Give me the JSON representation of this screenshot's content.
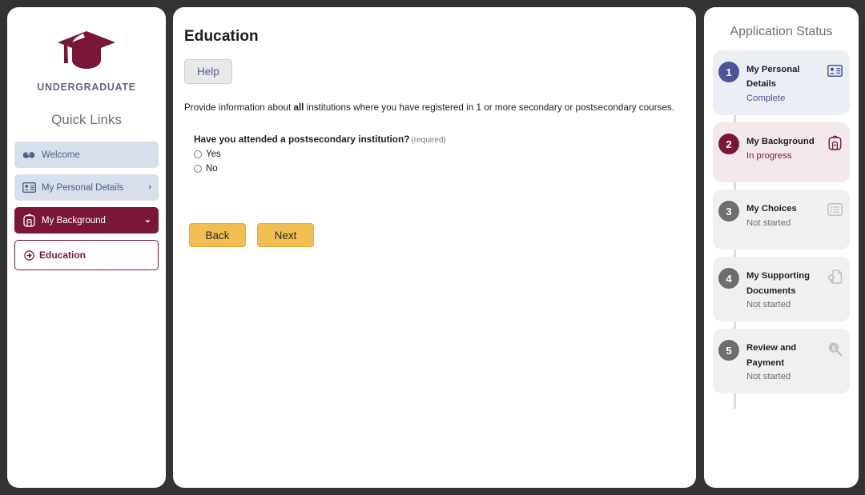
{
  "theme": {
    "page_background": "#333333",
    "maroon": "#7A1737",
    "indigo": "#4A5496",
    "gray": "#6E6E6E",
    "amber": "#F0BE51",
    "panel_background": "#FFFFFF"
  },
  "sidebar": {
    "logo_icon": "graduation-cap-icon",
    "brand": "UNDERGRADUATE",
    "quick_links_title": "Quick Links",
    "items": [
      {
        "label": "Welcome",
        "icon": "handshake-icon",
        "state": "plain",
        "chevron": ""
      },
      {
        "label": "My Personal Details",
        "icon": "id-card-icon",
        "state": "plain",
        "chevron": "›"
      },
      {
        "label": "My Background",
        "icon": "backpack-icon",
        "state": "active",
        "chevron": "⌄"
      }
    ],
    "sub_item": {
      "label": "Education",
      "icon": "circle-arrow-right-icon"
    }
  },
  "main": {
    "title": "Education",
    "help_label": "Help",
    "intro": {
      "before": "Provide information about ",
      "bold": "all",
      "after": " institutions where you have registered in 1 or more secondary or postsecondary courses."
    },
    "question": {
      "label": "Have you attended a postsecondary institution?",
      "required_note": "(required)",
      "options": [
        {
          "label": "Yes",
          "selected": false
        },
        {
          "label": "No",
          "selected": false
        }
      ]
    },
    "buttons": {
      "back_label": "Back",
      "next_label": "Next"
    }
  },
  "status": {
    "title": "Application Status",
    "steps": [
      {
        "number": "1",
        "name": "My Personal Details",
        "state": "Complete",
        "icon": "id-card-icon",
        "circle_color": "#4A5496",
        "background": "#ECEEF5",
        "state_color": "#4A5496",
        "icon_color": "#4A5496"
      },
      {
        "number": "2",
        "name": "My Background",
        "state": "In progress",
        "icon": "backpack-icon",
        "circle_color": "#7A1737",
        "background": "#F3E9EC",
        "state_color": "#7A1737",
        "icon_color": "#7A1737"
      },
      {
        "number": "3",
        "name": "My Choices",
        "state": "Not started",
        "icon": "list-icon",
        "circle_color": "#6E6E6E",
        "background": "#F0F0F0",
        "state_color": "#6E6E6E",
        "icon_color": "#C2C2C2"
      },
      {
        "number": "4",
        "name": "My Supporting Documents",
        "state": "Not started",
        "icon": "document-search-icon",
        "circle_color": "#6E6E6E",
        "background": "#F0F0F0",
        "state_color": "#6E6E6E",
        "icon_color": "#C2C2C2"
      },
      {
        "number": "5",
        "name": "Review and Payment",
        "state": "Not started",
        "icon": "payment-search-icon",
        "circle_color": "#6E6E6E",
        "background": "#F0F0F0",
        "state_color": "#6E6E6E",
        "icon_color": "#C2C2C2"
      }
    ]
  }
}
